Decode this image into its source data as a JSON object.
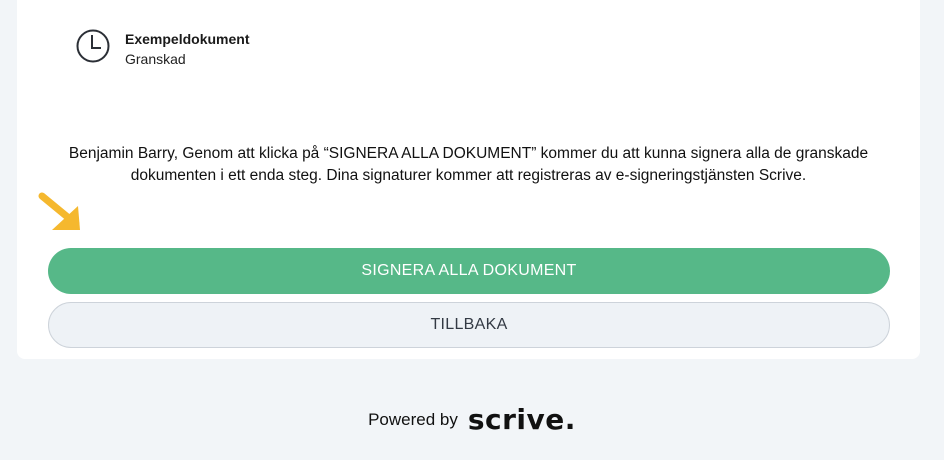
{
  "document": {
    "title": "Exempeldokument",
    "status": "Granskad",
    "status_icon": "clock-icon"
  },
  "info": {
    "text": "Benjamin Barry, Genom att klicka på “SIGNERA ALLA DOKUMENT” kommer du att kunna signera alla de granskade dokumenten i ett enda steg. Dina signaturer kommer att registreras av e-signeringstjänsten Scrive."
  },
  "actions": {
    "sign_all_label": "SIGNERA ALLA DOKUMENT",
    "back_label": "TILLBAKA"
  },
  "footer": {
    "powered_by": "Powered by",
    "brand": "scrive."
  },
  "colors": {
    "primary": "#56b888",
    "arrow": "#f5b82e",
    "background": "#f2f5f8"
  }
}
